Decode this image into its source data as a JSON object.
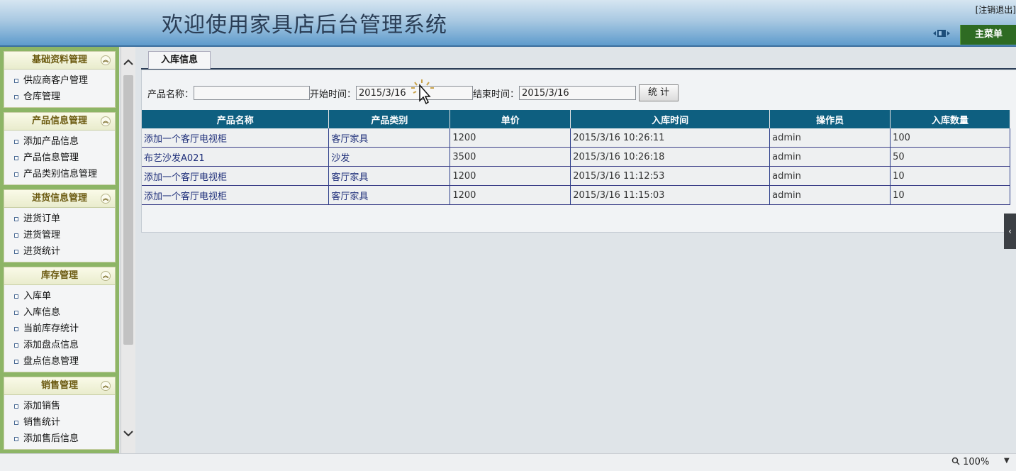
{
  "header": {
    "title": "欢迎使用家具店后台管理系统",
    "logout": "[注销退出]",
    "main_menu": "主菜单"
  },
  "sidebar": {
    "groups": [
      {
        "title": "基础资料管理",
        "items": [
          "供应商客户管理",
          "仓库管理"
        ]
      },
      {
        "title": "产品信息管理",
        "items": [
          "添加产品信息",
          "产品信息管理",
          "产品类别信息管理"
        ]
      },
      {
        "title": "进货信息管理",
        "items": [
          "进货订单",
          "进货管理",
          "进货统计"
        ]
      },
      {
        "title": "库存管理",
        "items": [
          "入库单",
          "入库信息",
          "当前库存统计",
          "添加盘点信息",
          "盘点信息管理"
        ]
      },
      {
        "title": "销售管理",
        "items": [
          "添加销售",
          "销售统计",
          "添加售后信息"
        ]
      }
    ]
  },
  "tab": {
    "label": "入库信息"
  },
  "search": {
    "product_name_label": "产品名称：",
    "product_name_value": "",
    "start_label": "开始时间：",
    "start_value": "2015/3/16",
    "end_label": "结束时间：",
    "end_value": "2015/3/16",
    "stat_button": "统 计"
  },
  "table": {
    "columns": [
      "产品名称",
      "产品类别",
      "单价",
      "入库时间",
      "操作员",
      "入库数量"
    ],
    "rows": [
      [
        "添加一个客厅电视柜",
        "客厅家具",
        "1200",
        "2015/3/16 10:26:11",
        "admin",
        "100"
      ],
      [
        "布艺沙发A021",
        "沙发",
        "3500",
        "2015/3/16 10:26:18",
        "admin",
        "50"
      ],
      [
        "添加一个客厅电视柜",
        "客厅家具",
        "1200",
        "2015/3/16 11:12:53",
        "admin",
        "10"
      ],
      [
        "添加一个客厅电视柜",
        "客厅家具",
        "1200",
        "2015/3/16 11:15:03",
        "admin",
        "10"
      ]
    ]
  },
  "statusbar": {
    "zoom": "100%"
  },
  "icons": {
    "collapse": "chevron-up-icon",
    "scroll_up": "chevron-up-icon",
    "scroll_down": "chevron-down-icon",
    "zoom": "magnifier-icon",
    "edge": "chevron-left-icon"
  },
  "colors": {
    "table_header": "#0e5f80",
    "sidebar": "#8db566",
    "main_menu": "#2e6b23"
  }
}
